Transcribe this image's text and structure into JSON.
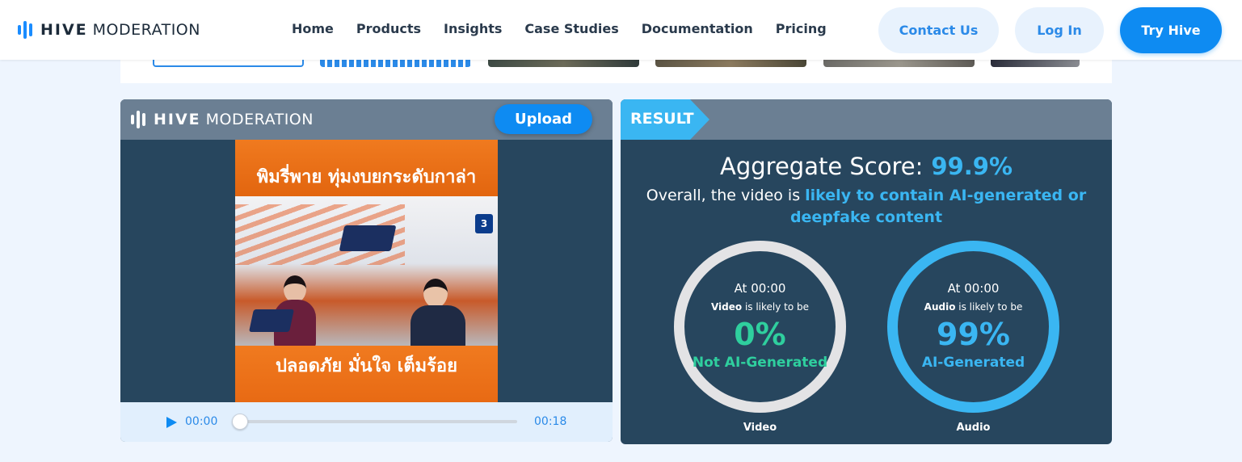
{
  "nav": {
    "logo_bold": "HIVE",
    "logo_light": "MODERATION",
    "links": [
      "Home",
      "Products",
      "Insights",
      "Case Studies",
      "Documentation",
      "Pricing"
    ],
    "contact_label": "Contact Us",
    "login_label": "Log In",
    "try_label": "Try Hive"
  },
  "player_panel": {
    "logo_bold": "HIVE",
    "logo_light": "MODERATION",
    "upload_label": "Upload",
    "video_top_text": "พิมรี่พาย ทุ่มงบยกระดับกาล่า",
    "video_bottom_text": "ปลอดภัย มั่นใจ เต็มร้อย",
    "channel_badge": "3",
    "time_current": "00:00",
    "time_total": "00:18",
    "progress": 0
  },
  "result": {
    "tag": "RESULT",
    "aggregate_label": "Aggregate Score:",
    "aggregate_value": "99.9%",
    "overall_prefix": "Overall, the video is ",
    "overall_highlight": "likely to contain AI-generated or deepfake content",
    "video": {
      "at": "At 00:00",
      "kind": "Video",
      "likely_suffix": " is likely to be",
      "percent": "0%",
      "label": "Not AI-Generated",
      "caption": "Video"
    },
    "audio": {
      "at": "At 00:00",
      "kind": "Audio",
      "likely_suffix": " is likely to be",
      "percent": "99%",
      "label": "AI-Generated",
      "caption": "Audio"
    }
  },
  "colors": {
    "accent_blue": "#0e8bf2",
    "result_blue": "#3ab6f2",
    "not_ai_green": "#2fcf9e",
    "panel_dark": "#27465e",
    "panel_header": "#6b7f93"
  }
}
